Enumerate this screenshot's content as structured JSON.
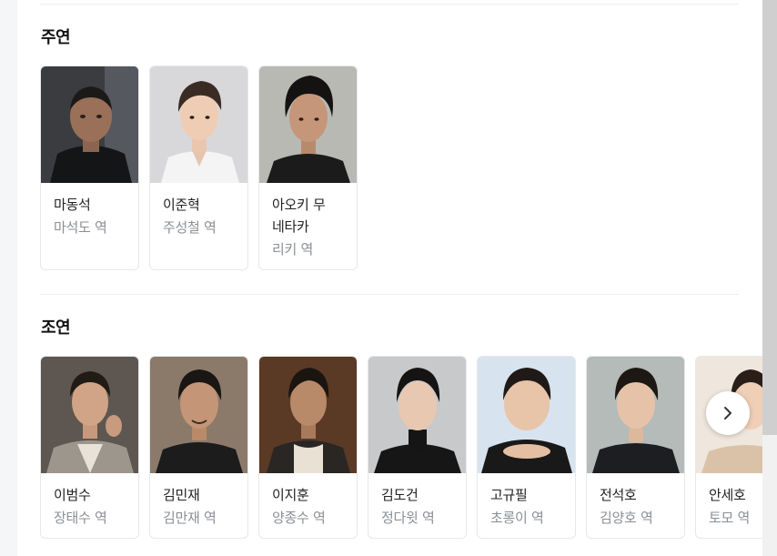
{
  "main_cast": {
    "title": "주연",
    "items": [
      {
        "name": "마동석",
        "role": "마석도 역"
      },
      {
        "name": "이준혁",
        "role": "주성철 역"
      },
      {
        "name": "아오키 무\n네타카",
        "role": "리키 역"
      }
    ]
  },
  "supporting_cast": {
    "title": "조연",
    "items": [
      {
        "name": "이범수",
        "role": "장태수 역"
      },
      {
        "name": "김민재",
        "role": "김만재 역"
      },
      {
        "name": "이지훈",
        "role": "양종수 역"
      },
      {
        "name": "김도건",
        "role": "정다윗 역"
      },
      {
        "name": "고규필",
        "role": "초롱이 역"
      },
      {
        "name": "전석호",
        "role": "김양호 역"
      },
      {
        "name": "안세호",
        "role": "토모 역"
      }
    ]
  },
  "icons": {
    "next": "chevron-right-icon"
  }
}
